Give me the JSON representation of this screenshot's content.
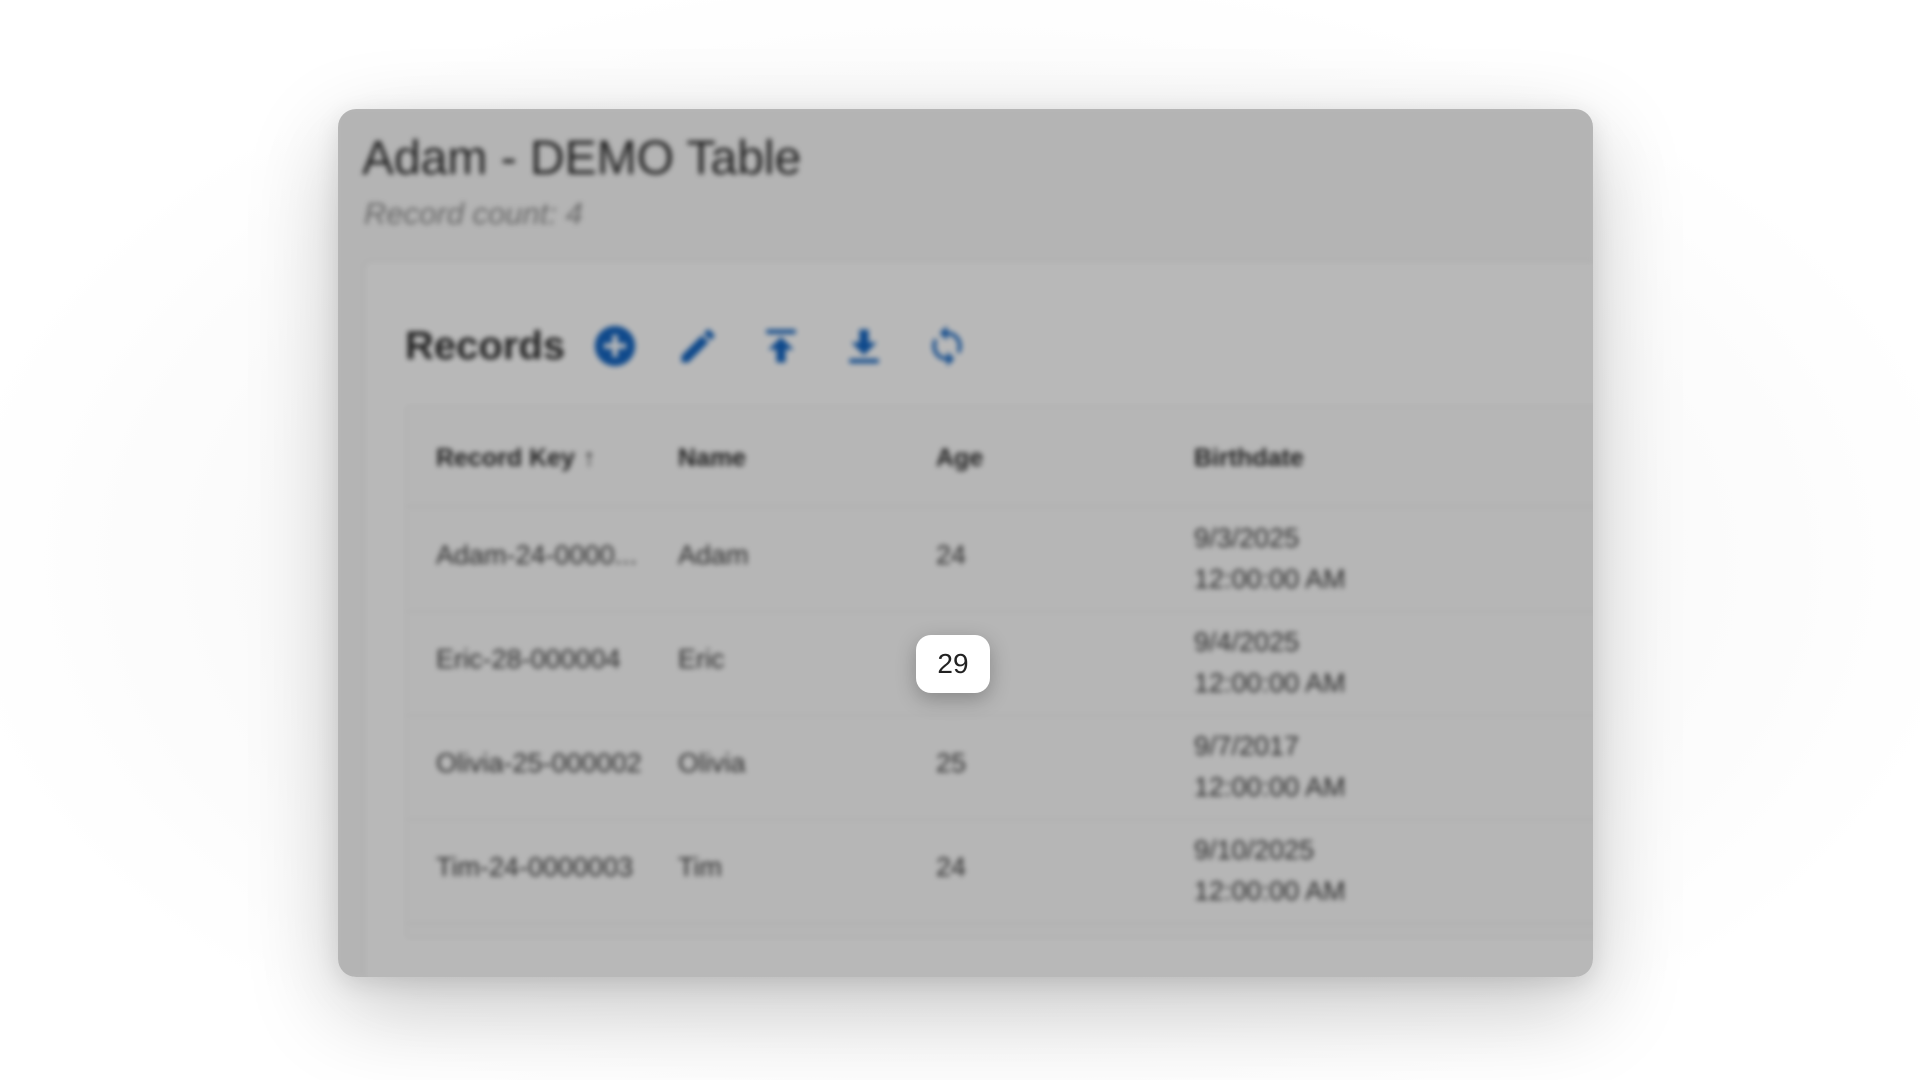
{
  "page": {
    "title": "Adam - DEMO Table",
    "record_count": "Record count: 4"
  },
  "records": {
    "title": "Records",
    "toolbar": [
      {
        "name": "add-circle-icon",
        "color": "#1565c0"
      },
      {
        "name": "pencil-icon",
        "color": "#1565c0"
      },
      {
        "name": "upload-icon",
        "color": "#1565c0"
      },
      {
        "name": "download-icon",
        "color": "#1565c0"
      },
      {
        "name": "refresh-icon",
        "color": "#1565c0"
      }
    ]
  },
  "table": {
    "columns": [
      "Record Key",
      "Name",
      "Age",
      "Birthdate"
    ],
    "sort_indicator": "↑",
    "rows": [
      {
        "key": "Adam-24-0000...",
        "name": "Adam",
        "age": "24",
        "birth_date": "9/3/2025",
        "birth_time": "12:00:00 AM"
      },
      {
        "key": "Eric-28-000004",
        "name": "Eric",
        "age": "29",
        "birth_date": "9/4/2025",
        "birth_time": "12:00:00 AM"
      },
      {
        "key": "Olivia-25-000002",
        "name": "Olivia",
        "age": "25",
        "birth_date": "9/7/2017",
        "birth_time": "12:00:00 AM"
      },
      {
        "key": "Tim-24-0000003",
        "name": "Tim",
        "age": "24",
        "birth_date": "9/10/2025",
        "birth_time": "12:00:00 AM"
      }
    ]
  },
  "focus": {
    "value": "29"
  },
  "colors": {
    "accent": "#1565c0",
    "dim_overlay": "rgba(0,0,0,0.27)"
  }
}
